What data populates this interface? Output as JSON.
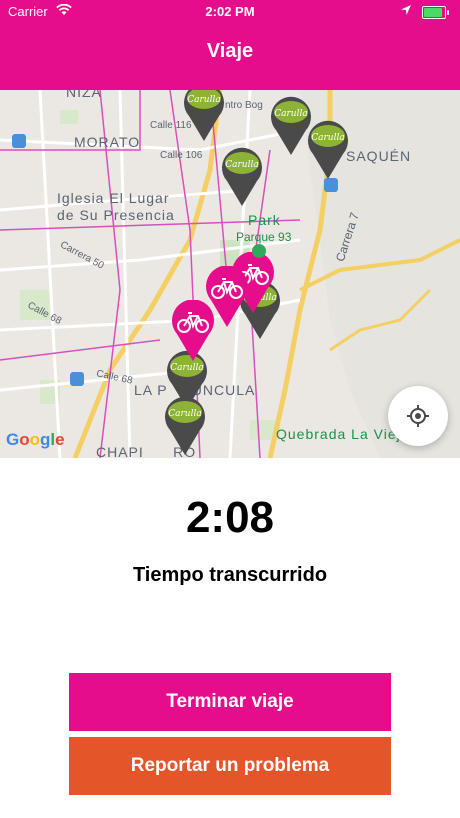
{
  "status_bar": {
    "carrier": "Carrier",
    "time": "2:02 PM"
  },
  "nav": {
    "title": "Viaje"
  },
  "map": {
    "labels": {
      "niza": "NIZA",
      "morato": "MORATO",
      "iglesia1": "Iglesia El Lugar",
      "iglesia2": "de Su Presencia",
      "park": "Park",
      "parque93": "Parque 93",
      "usaquen": "SAQUÉN",
      "carrera7": "Carrera 7",
      "calle116": "Calle 116",
      "calle106": "Calle 106",
      "carrera50": "Carrera 50",
      "calle68a": "Calle 68",
      "calle68b": "Calle 68",
      "porciuncula": "LA P     ÚNCULA",
      "chapinero": "CHAPI      RO",
      "quebrada": "Quebrada La Vieja",
      "centro": "ntro Bog"
    },
    "pin_label": "Carulla",
    "attribution": "Google",
    "colors": {
      "store_pin": "#4a4a4a",
      "store_badge": "#8cb336",
      "bike_pin": "#e60d8c"
    }
  },
  "trip": {
    "elapsed": "2:08",
    "elapsed_label": "Tiempo transcurrido"
  },
  "actions": {
    "end_trip": "Terminar viaje",
    "report_problem": "Reportar un problema"
  },
  "theme": {
    "primary": "#e60d8c",
    "secondary": "#e4552a"
  }
}
